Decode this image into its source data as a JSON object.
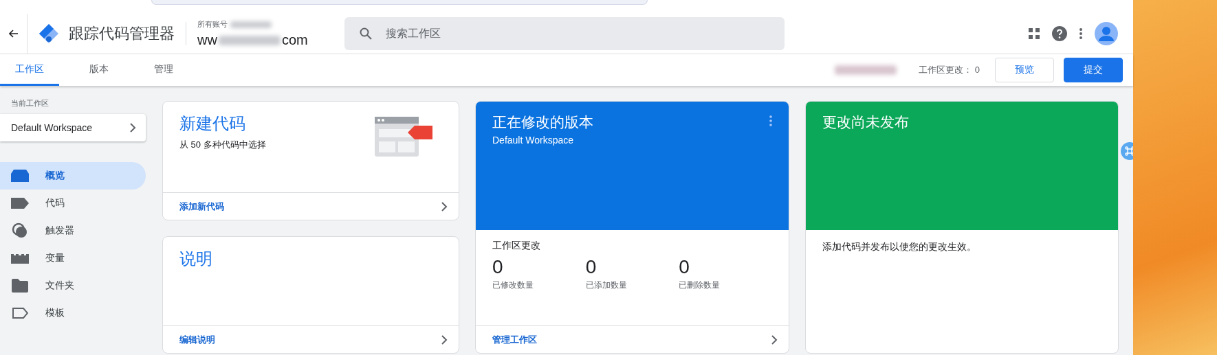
{
  "header": {
    "title": "跟踪代码管理器",
    "account": "所有账号",
    "container_start": "ww",
    "container_end": "com",
    "search": {
      "placeholder": "搜索工作区"
    }
  },
  "tabs": [
    {
      "label": "工作区",
      "selected": true
    },
    {
      "label": "版本",
      "selected": false
    },
    {
      "label": "管理",
      "selected": false
    }
  ],
  "changes": {
    "label": "工作区更改：",
    "count": "0"
  },
  "buttons": [
    {
      "label": "预览",
      "kind": "outline"
    },
    {
      "label": "提交",
      "kind": "primary"
    }
  ],
  "sidebar": {
    "label": "当前工作区",
    "workspace": "Default Workspace",
    "items": [
      {
        "label": "概览",
        "kind": "overview",
        "selected": true
      },
      {
        "label": "代码",
        "kind": "tag",
        "selected": false
      },
      {
        "label": "触发器",
        "kind": "trigger",
        "selected": false
      },
      {
        "label": "变量",
        "kind": "variable",
        "selected": false
      },
      {
        "label": "文件夹",
        "kind": "folder",
        "selected": false
      },
      {
        "label": "模板",
        "kind": "template",
        "selected": false
      }
    ]
  },
  "new_tag": {
    "title": "新建代码",
    "subtitle": "从 50 多种代码中选择",
    "link": "添加新代码"
  },
  "description": {
    "title": "说明",
    "link": "编辑说明"
  },
  "version": {
    "title": "正在修改的版本",
    "subtitle": "Default Workspace",
    "section_title": "工作区更改",
    "stats": [
      {
        "value": "0",
        "label": "已修改数量"
      },
      {
        "value": "0",
        "label": "已添加数量"
      },
      {
        "value": "0",
        "label": "已删除数量"
      }
    ],
    "link": "管理工作区"
  },
  "publish": {
    "title": "更改尚未发布",
    "text": "添加代码并发布以使您的更改生效。"
  }
}
